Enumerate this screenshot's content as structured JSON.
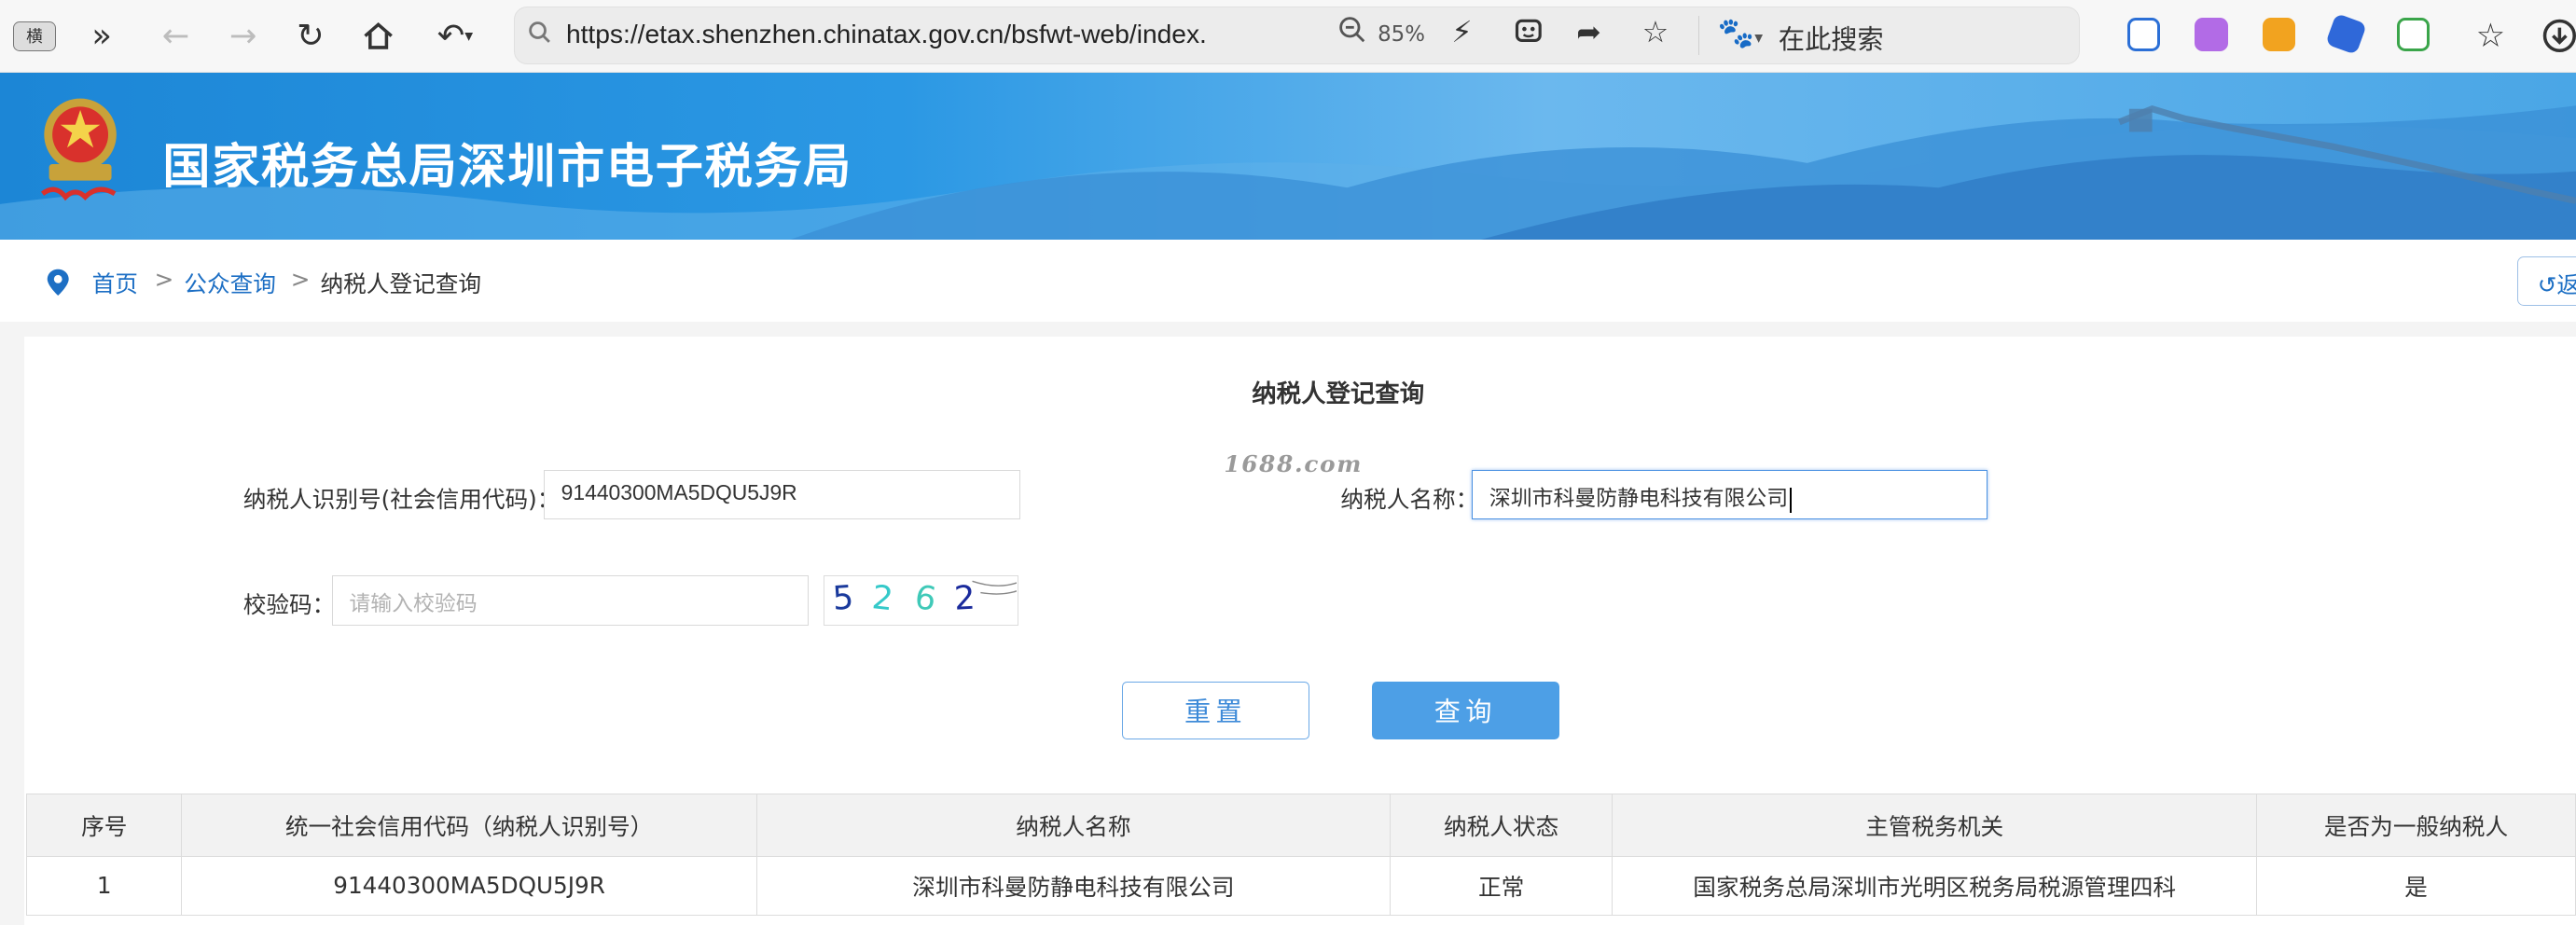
{
  "browser": {
    "tab_key_label": "横",
    "url": "https://etax.shenzhen.chinatax.gov.cn/bsfwt-web/index.",
    "zoom": "85%",
    "search_placeholder": "在此搜索"
  },
  "site": {
    "title": "国家税务总局深圳市电子税务局"
  },
  "breadcrumb": {
    "home": "首页",
    "public_query": "公众查询",
    "current": "纳税人登记查询",
    "separator": ">",
    "back_label": "↺返"
  },
  "form": {
    "title": "纳税人登记查询",
    "watermark": "1688.com",
    "taxpayer_id_label": "纳税人识别号(社会信用代码)：",
    "taxpayer_id_value": "91440300MA5DQU5J9R",
    "taxpayer_name_label": "纳税人名称：",
    "taxpayer_name_value": "深圳市科曼防静电科技有限公司",
    "captcha_label": "校验码：",
    "captcha_placeholder": "请输入校验码",
    "captcha_text": [
      "5",
      "2",
      "6",
      "2"
    ],
    "captcha_colors": [
      "#1a3a9c",
      "#35c9c9",
      "#3fc9b8",
      "#1a2a9c"
    ],
    "reset_label": "重置",
    "query_label": "查询"
  },
  "table": {
    "headers": [
      "序号",
      "统一社会信用代码（纳税人识别号）",
      "纳税人名称",
      "纳税人状态",
      "主管税务机关",
      "是否为一般纳税人"
    ],
    "rows": [
      [
        "1",
        "91440300MA5DQU5J9R",
        "深圳市科曼防静电科技有限公司",
        "正常",
        "国家税务总局深圳市光明区税务局税源管理四科",
        "是"
      ]
    ]
  },
  "colors": {
    "accent": "#4d9fe6",
    "link": "#1d6fc4",
    "banner": "#2b98e4"
  }
}
